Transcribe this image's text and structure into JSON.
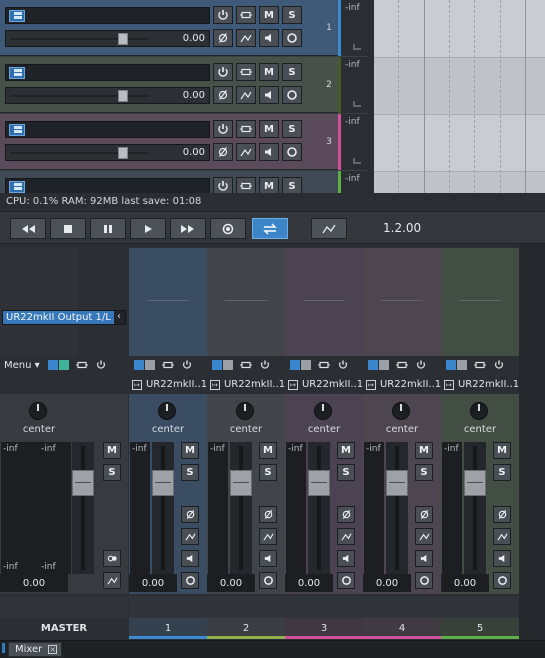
{
  "colors": {
    "accent_blue": "#3c86c8",
    "track1": "#3f5a78",
    "track2": "#48504a",
    "track3": "#5a4a5a",
    "strip_blue": "#3a4d62",
    "strip_gray": "#41454a",
    "strip_purple": "#4b4252",
    "strip_mauve": "#4d4550",
    "strip_green": "#424d43",
    "foot_blue": "#3b89d0",
    "foot_olive": "#8fb24a",
    "foot_pink": "#d0509a",
    "foot_green": "#5db047"
  },
  "tracks": [
    {
      "number": "1",
      "volume": "0.00",
      "level": "-inf",
      "buttons": {
        "mute": "M",
        "solo": "S"
      }
    },
    {
      "number": "2",
      "volume": "0.00",
      "level": "-inf",
      "buttons": {
        "mute": "M",
        "solo": "S"
      }
    },
    {
      "number": "3",
      "volume": "0.00",
      "level": "-inf",
      "buttons": {
        "mute": "M",
        "solo": "S"
      }
    },
    {
      "number": "",
      "volume": "",
      "level": "-inf",
      "buttons": {
        "mute": "M",
        "solo": "S"
      }
    }
  ],
  "status": {
    "text": "CPU: 0.1% RAM: 92MB  last save: 01:08"
  },
  "transport": {
    "position": "1.2.00",
    "icons": [
      "rewind-icon",
      "stop-icon",
      "pause-icon",
      "play-icon",
      "fast-forward-icon",
      "record-icon",
      "loop-icon",
      "automation-icon"
    ]
  },
  "master": {
    "output_selector": "UR22mkII Output 1/L",
    "menu_label": "Menu",
    "pan": "center",
    "meter_left_top": "-inf",
    "meter_right_top": "-inf",
    "meter_left_bottom": "-inf",
    "meter_right_bottom": "-inf",
    "volume": "0.00",
    "mute": "M",
    "solo": "S",
    "name": "MASTER"
  },
  "channels": [
    {
      "output": "UR22mkII..1",
      "pan": "center",
      "meter": "-inf",
      "volume": "0.00",
      "mute": "M",
      "solo": "S",
      "name": "1"
    },
    {
      "output": "UR22mkII..1",
      "pan": "center",
      "meter": "-inf",
      "volume": "0.00",
      "mute": "M",
      "solo": "S",
      "name": "2"
    },
    {
      "output": "UR22mkII..1",
      "pan": "center",
      "meter": "-inf",
      "volume": "0.00",
      "mute": "M",
      "solo": "S",
      "name": "3"
    },
    {
      "output": "UR22mkII..1",
      "pan": "center",
      "meter": "-inf",
      "volume": "0.00",
      "mute": "M",
      "solo": "S",
      "name": "4"
    },
    {
      "output": "UR22mkII..1",
      "pan": "center",
      "meter": "-inf",
      "volume": "0.00",
      "mute": "M",
      "solo": "S",
      "name": "5"
    }
  ],
  "tabs": {
    "mixer": "Mixer"
  }
}
